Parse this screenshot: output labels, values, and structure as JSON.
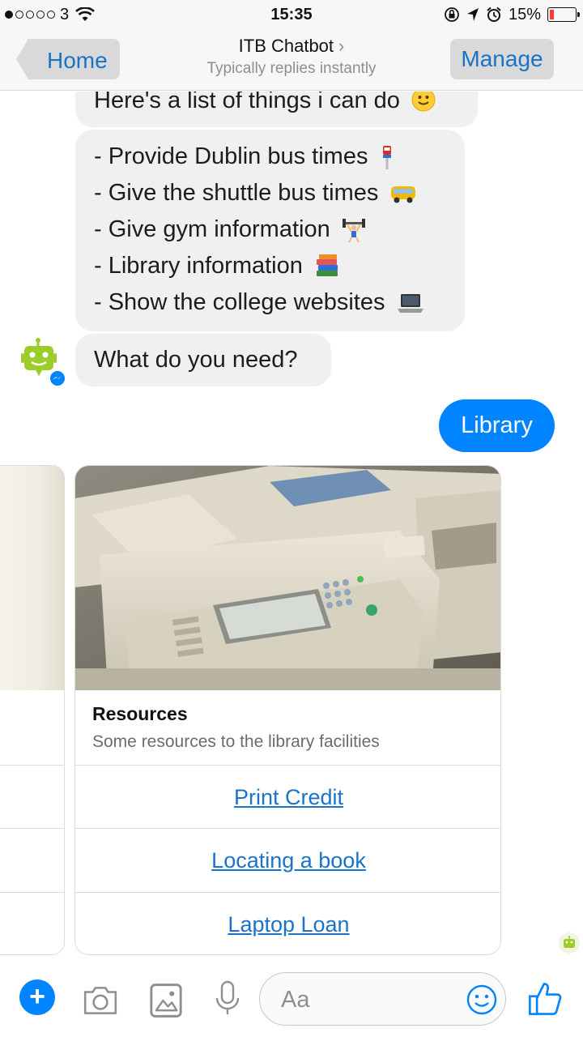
{
  "status_bar": {
    "carrier": "3",
    "time": "15:35",
    "battery_percent": "15%",
    "battery_level": 0.15,
    "signal_bars_filled": 1,
    "icons": [
      "signal-dots-icon",
      "wifi-icon",
      "rotation-lock-icon",
      "location-arrow-icon",
      "alarm-icon",
      "battery-icon"
    ]
  },
  "nav": {
    "back_label": "Home",
    "title": "ITB Chatbot",
    "title_chevron": "›",
    "subtitle": "Typically replies instantly",
    "manage_label": "Manage"
  },
  "messages": {
    "intro": "Here's a list of things i can do",
    "capabilities": [
      "- Provide Dublin bus times",
      "- Give the shuttle bus times",
      "- Give gym information",
      "- Library information",
      "- Show the college websites"
    ],
    "question": "What do you need?",
    "user_reply": "Library"
  },
  "card": {
    "title": "Resources",
    "subtitle": "Some resources to the library facilities",
    "buttons": [
      "Print Credit",
      "Locating a book",
      "Laptop Loan"
    ],
    "image_alt": "photocopier-image"
  },
  "composer": {
    "placeholder": "Aa"
  },
  "colors": {
    "accent": "#0084ff",
    "link": "#1a73c8",
    "bubble": "#f1f0f0",
    "bot_green": "#9ccc2a"
  }
}
